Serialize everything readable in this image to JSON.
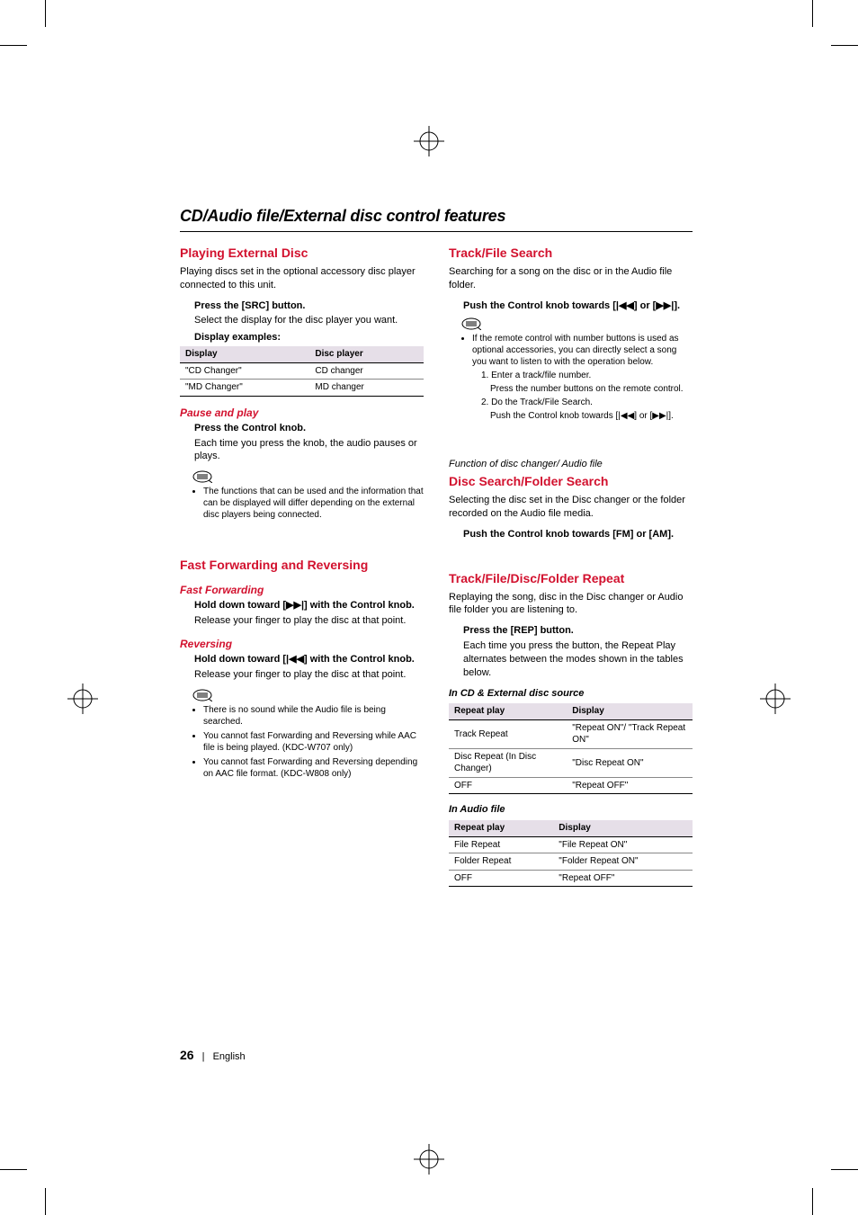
{
  "chapter": {
    "title": "CD/Audio file/External disc control features"
  },
  "left": {
    "s1": {
      "head": "Playing External Disc",
      "intro": "Playing discs set in the optional accessory disc player connected to this unit.",
      "step1b": "Press the [SRC] button.",
      "step1t": "Select the display for the disc player you want.",
      "disp_ex": "Display examples:",
      "table": {
        "h1": "Display",
        "h2": "Disc player",
        "r1c1": "\"CD Changer\"",
        "r1c2": "CD changer",
        "r2c1": "\"MD Changer\"",
        "r2c2": "MD changer"
      },
      "sub": "Pause and play",
      "sub_b": "Press the Control knob.",
      "sub_t": "Each time you press the knob, the audio pauses or plays.",
      "note1": "The functions that can be used and the information that can be displayed will differ depending on the external disc players being connected."
    },
    "s2": {
      "head": "Fast Forwarding and Reversing",
      "ff_sub": "Fast Forwarding",
      "ff_b": "Hold down toward [▶▶|] with the Control knob.",
      "ff_t": "Release your finger to play the disc at that point.",
      "rv_sub": "Reversing",
      "rv_b": "Hold down toward [|◀◀] with the Control knob.",
      "rv_t": "Release your finger to play the disc at that point.",
      "note1": "There is no sound while the Audio file is being searched.",
      "note2": "You cannot fast Forwarding and Reversing while AAC file is being played. (KDC-W707 only)",
      "note3": "You cannot fast Forwarding and Reversing depending on AAC file format. (KDC-W808 only)"
    }
  },
  "right": {
    "s1": {
      "head": "Track/File Search",
      "intro": "Searching for a song on the disc or in the Audio file folder.",
      "step_b": "Push the Control knob towards [|◀◀] or [▶▶|].",
      "note1": "If the remote control with number buttons is used as optional accessories, you can directly select a song you want to listen to with the operation below.",
      "note1a": "1. Enter a track/file number.",
      "note1a_t": "Press the number buttons on the remote control.",
      "note1b": "2. Do the Track/File Search.",
      "note1b_t": "Push the Control knob towards [|◀◀] or [▶▶|]."
    },
    "s2": {
      "func": "Function of disc changer/ Audio file",
      "head": "Disc Search/Folder Search",
      "intro": "Selecting the disc set in the Disc changer or the folder recorded on the Audio file media.",
      "step_b": "Push the Control knob towards [FM] or [AM]."
    },
    "s3": {
      "head": "Track/File/Disc/Folder Repeat",
      "intro": "Replaying the song, disc in the Disc changer or Audio file folder you are listening to.",
      "step_b": "Press the [REP] button.",
      "step_t": "Each time you press the button, the Repeat Play alternates between the modes shown in the tables below.",
      "tbl1_label": "In CD & External disc source",
      "tbl1": {
        "h1": "Repeat play",
        "h2": "Display",
        "r1c1": "Track Repeat",
        "r1c2": "\"Repeat ON\"/ \"Track Repeat ON\"",
        "r2c1": "Disc Repeat (In Disc Changer)",
        "r2c2": "\"Disc Repeat ON\"",
        "r3c1": "OFF",
        "r3c2": "\"Repeat OFF\""
      },
      "tbl2_label": "In Audio file",
      "tbl2": {
        "h1": "Repeat play",
        "h2": "Display",
        "r1c1": "File Repeat",
        "r1c2": "\"File Repeat ON\"",
        "r2c1": "Folder Repeat",
        "r2c2": "\"Folder Repeat ON\"",
        "r3c1": "OFF",
        "r3c2": "\"Repeat OFF\""
      }
    }
  },
  "footer": {
    "page": "26",
    "lang": "English"
  }
}
